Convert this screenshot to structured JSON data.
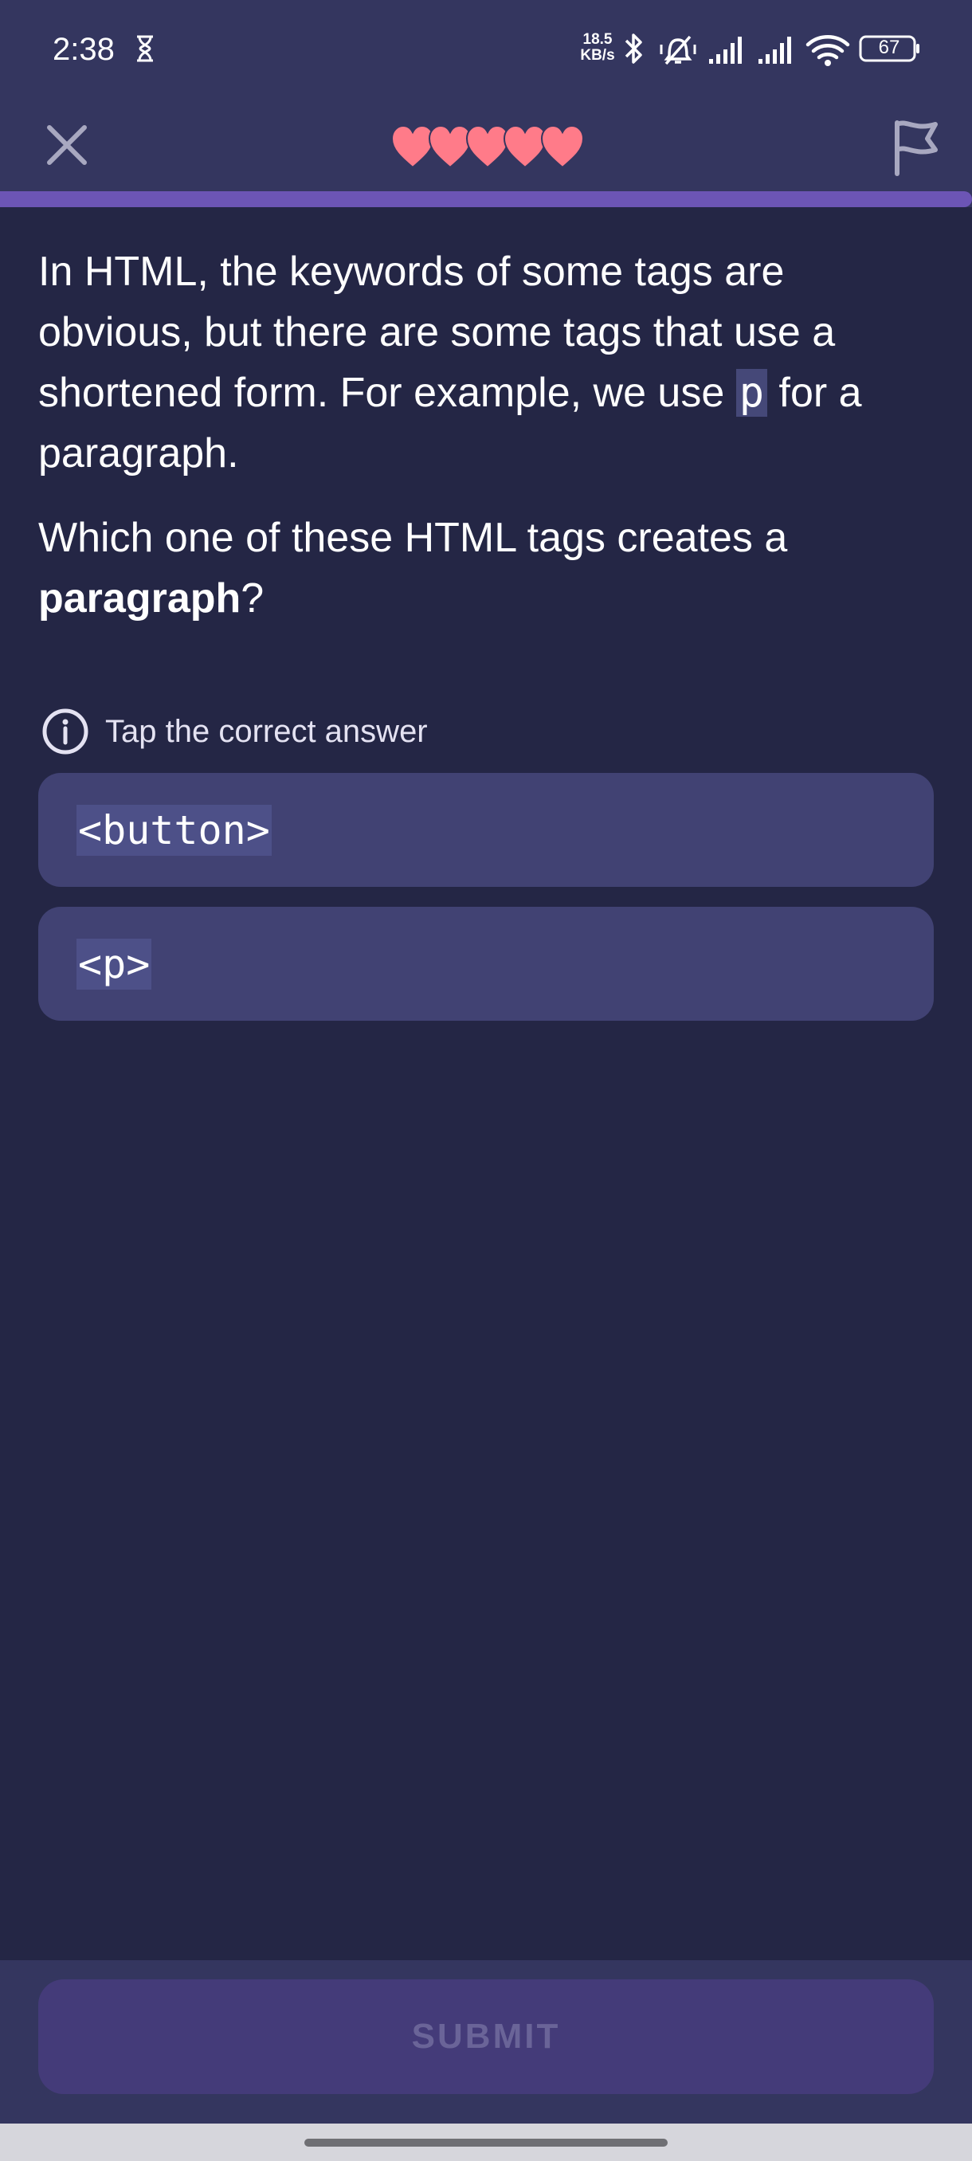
{
  "status_bar": {
    "time": "2:38",
    "network_speed_value": "18.5",
    "network_speed_unit": "KB/s",
    "battery": "67",
    "icons": [
      "hourglass-icon",
      "bluetooth-icon",
      "mute-icon",
      "signal-icon",
      "signal-icon",
      "wifi-icon",
      "battery-icon"
    ]
  },
  "header": {
    "close_icon": "close-icon",
    "flag_icon": "flag-icon",
    "lives": 5,
    "progress": 1.0,
    "colors": {
      "heart": "#ff7b89",
      "progress": "#6c55b5",
      "bar": "#34365f"
    }
  },
  "question": {
    "p1_before": "In HTML, the keywords of some tags are obvious, but there are some tags that use a shortened form. For example, we use ",
    "p1_code": "p",
    "p1_after": " for a paragraph.",
    "p2_before": "Which one of these HTML tags creates a ",
    "p2_bold": "paragraph",
    "p2_after": "?"
  },
  "hint": {
    "icon": "info-icon",
    "text": "Tap the correct answer"
  },
  "answers": [
    {
      "label": "<button>"
    },
    {
      "label": "<p>"
    }
  ],
  "submit": {
    "label": "SUBMIT"
  }
}
